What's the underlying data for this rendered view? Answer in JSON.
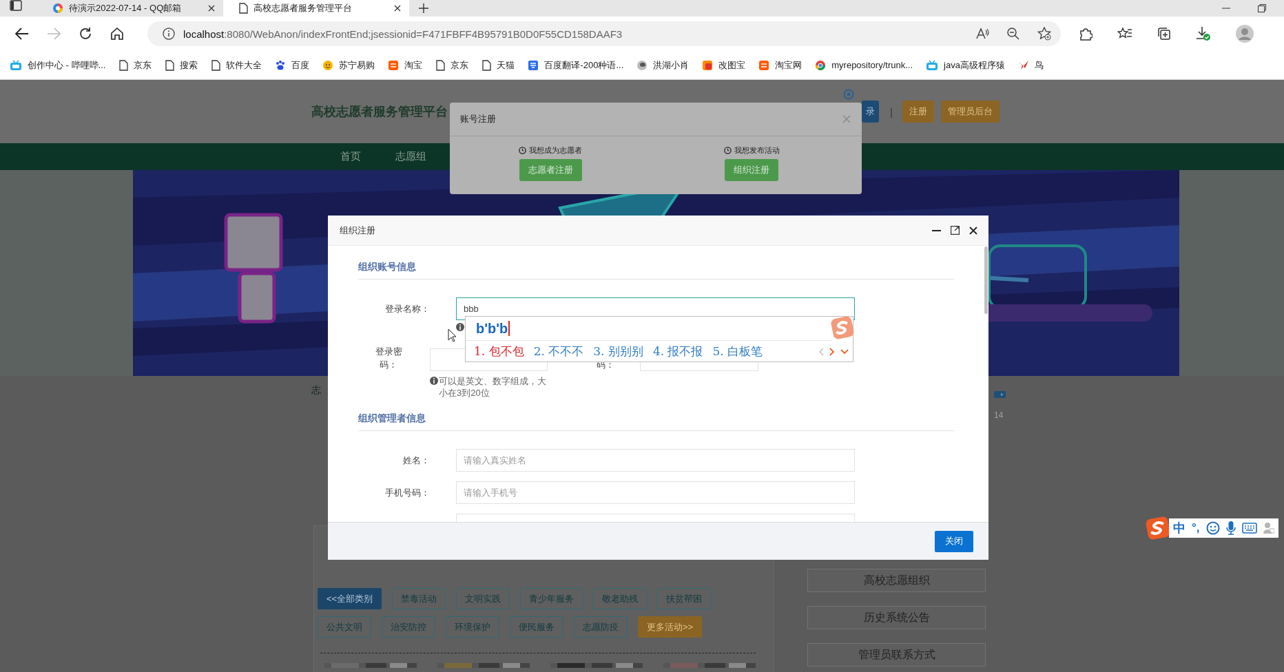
{
  "browser": {
    "tabs": [
      {
        "title": "待演示2022-07-14 - QQ邮箱",
        "selected": false
      },
      {
        "title": "高校志愿者服务管理平台",
        "selected": true
      }
    ],
    "address": {
      "host": "localhost",
      "rest": ":8080/WebAnon/indexFrontEnd;jsessionid=F471FBFF4B95791B0D0F55CD158DAAF3"
    },
    "bookmarks": [
      {
        "label": "创作中心 - 哔哩哔..."
      },
      {
        "label": "京东"
      },
      {
        "label": "搜索"
      },
      {
        "label": "软件大全"
      },
      {
        "label": "百度"
      },
      {
        "label": "苏宁易购"
      },
      {
        "label": "淘宝"
      },
      {
        "label": "京东"
      },
      {
        "label": "天猫"
      },
      {
        "label": "百度翻译-200种语..."
      },
      {
        "label": "洪湖小肖"
      },
      {
        "label": "改图宝"
      },
      {
        "label": "淘宝网"
      },
      {
        "label": "myrepository/trunk..."
      },
      {
        "label": "java高级程序猿"
      },
      {
        "label": "鸟"
      }
    ]
  },
  "page": {
    "site_title": "高校志愿者服务管理平台",
    "header_buttons": [
      {
        "label": "录",
        "kind": "primary"
      },
      {
        "label": "|",
        "kind": "separator"
      },
      {
        "label": "注册",
        "kind": "warning"
      },
      {
        "label": "管理员后台",
        "kind": "warning"
      }
    ],
    "nav": [
      "首页",
      "志愿组"
    ],
    "section_tab": "志",
    "date_fragment": "14",
    "categories": [
      {
        "label": "<<全部类别",
        "kind": "primary"
      },
      {
        "label": "禁毒活动",
        "kind": "outline"
      },
      {
        "label": "文明实践",
        "kind": "outline"
      },
      {
        "label": "青少年服务",
        "kind": "outline"
      },
      {
        "label": "敬老助残",
        "kind": "outline"
      },
      {
        "label": "扶贫帮困",
        "kind": "outline"
      },
      {
        "label": "公共文明",
        "kind": "outline"
      },
      {
        "label": "治安防控",
        "kind": "outline"
      },
      {
        "label": "环境保护",
        "kind": "outline"
      },
      {
        "label": "便民服务",
        "kind": "outline"
      },
      {
        "label": "志愿防疫",
        "kind": "outline"
      },
      {
        "label": "更多活动>>",
        "kind": "warning"
      }
    ],
    "sidebar_buttons": [
      "高校志愿组织",
      "历史系统公告",
      "管理员联系方式"
    ]
  },
  "account_dialog": {
    "title": "账号注册",
    "options": [
      {
        "hint": "我想成为志愿者",
        "button": "志愿者注册"
      },
      {
        "hint": "我想发布活动",
        "button": "组织注册"
      }
    ]
  },
  "org_dialog": {
    "title": "组织注册",
    "sections": [
      {
        "heading": "组织账号信息",
        "rows": [
          {
            "kind": "text",
            "label": "登录名称：",
            "value": "bbb",
            "focused": true
          },
          {
            "kind": "hint"
          },
          {
            "kind": "pair",
            "fields": [
              {
                "label": "登录密码：",
                "focused": false
              },
              {
                "label": "码：",
                "focused": false
              }
            ],
            "hint": "可以是英文、数字组成，大小在3到20位"
          }
        ]
      },
      {
        "heading": "组织管理者信息",
        "rows": [
          {
            "kind": "text",
            "label": "姓名：",
            "placeholder": "请输入真实姓名",
            "focused": false
          },
          {
            "kind": "text",
            "label": "手机号码：",
            "placeholder": "请输入手机号",
            "focused": false
          },
          {
            "kind": "text",
            "focused": false
          }
        ]
      }
    ],
    "footer_button": "关闭"
  },
  "ime": {
    "composition": "b'b'b",
    "candidates": [
      {
        "text": "1. 包不包",
        "selected": true
      },
      {
        "text": "2. 不不不",
        "selected": false
      },
      {
        "text": "3. 别别别",
        "selected": false
      },
      {
        "text": "4. 报不报",
        "selected": false
      },
      {
        "text": "5. 白板笔",
        "selected": false
      }
    ],
    "toolbar": {
      "mode": "中",
      "punctuation": "°,"
    }
  }
}
